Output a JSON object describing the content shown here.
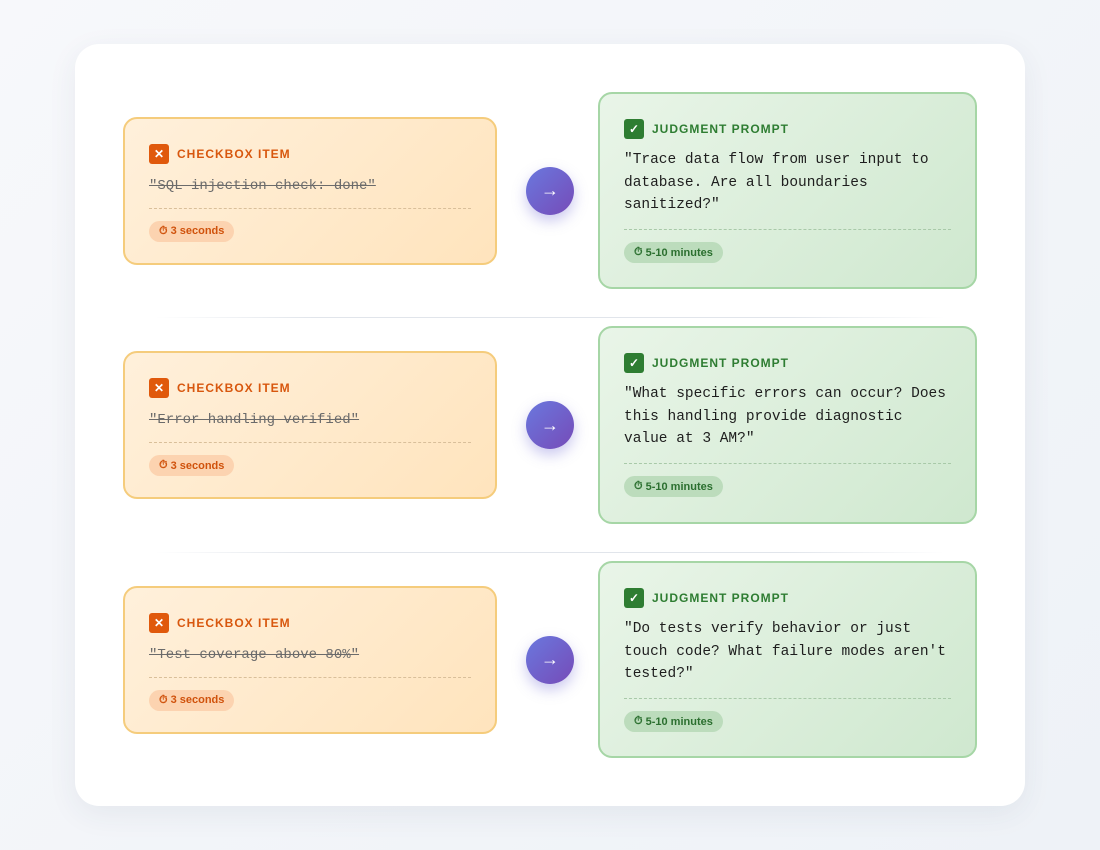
{
  "colors": {
    "checkbox_accent": "#e0590c",
    "judgment_accent": "#2e7d32",
    "arrow_start": "#6a78de",
    "arrow_end": "#764bb8"
  },
  "icons": {
    "checkbox": "✕",
    "judgment": "✓",
    "arrow": "→",
    "timer": "⏱"
  },
  "rows": [
    {
      "checkbox": {
        "label": "CHECKBOX ITEM",
        "text": "\"SQL injection check: done\"",
        "time": "3 seconds"
      },
      "judgment": {
        "label": "JUDGMENT PROMPT",
        "text": "\"Trace data flow from user input to database. Are all boundaries sanitized?\"",
        "time": "5-10 minutes"
      }
    },
    {
      "checkbox": {
        "label": "CHECKBOX ITEM",
        "text": "\"Error handling verified\"",
        "time": "3 seconds"
      },
      "judgment": {
        "label": "JUDGMENT PROMPT",
        "text": "\"What specific errors can occur? Does this handling provide diagnostic value at 3 AM?\"",
        "time": "5-10 minutes"
      }
    },
    {
      "checkbox": {
        "label": "CHECKBOX ITEM",
        "text": "\"Test coverage above 80%\"",
        "time": "3 seconds"
      },
      "judgment": {
        "label": "JUDGMENT PROMPT",
        "text": "\"Do tests verify behavior or just touch code? What failure modes aren't tested?\"",
        "time": "5-10 minutes"
      }
    }
  ]
}
